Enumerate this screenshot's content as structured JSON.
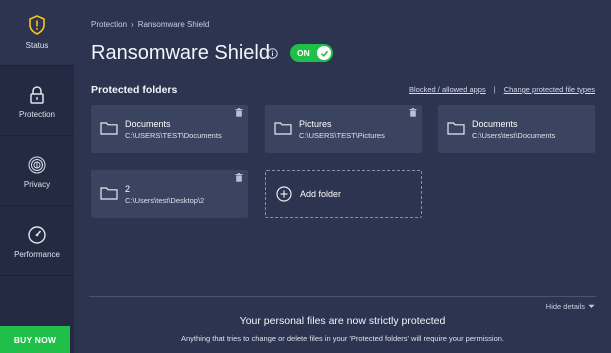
{
  "sidebar": {
    "items": [
      {
        "label": "Status",
        "icon": "shield-warning-icon"
      },
      {
        "label": "Protection",
        "icon": "lock-icon"
      },
      {
        "label": "Privacy",
        "icon": "fingerprint-icon"
      },
      {
        "label": "Performance",
        "icon": "speedometer-icon"
      }
    ],
    "buy_now": "BUY NOW"
  },
  "breadcrumb": {
    "parent": "Protection",
    "separator": "›",
    "current": "Ransomware Shield"
  },
  "header": {
    "title": "Ransomware Shield",
    "toggle_label": "ON"
  },
  "section": {
    "title": "Protected folders",
    "links": {
      "blocked": "Blocked / allowed apps",
      "separator": "|",
      "change": "Change protected file types"
    }
  },
  "folders": [
    {
      "name": "Documents",
      "path": "C:\\USERS\\TEST\\Documents"
    },
    {
      "name": "Pictures",
      "path": "C:\\USERS\\TEST\\Pictures"
    },
    {
      "name": "Documents",
      "path": "C:\\Users\\test\\Documents"
    },
    {
      "name": "2",
      "path": "C:\\Users\\test\\Desktop\\2"
    }
  ],
  "add_folder": "Add folder",
  "details": {
    "hide": "Hide details",
    "title": "Your personal files are now strictly protected",
    "text": "Anything that tries to change or delete files in your 'Protected folders' will require your permission."
  },
  "colors": {
    "accent_green": "#1fbf4a",
    "sidebar_bg": "#232a42",
    "main_bg": "#2c3450",
    "card_bg": "#3a4360",
    "status_yellow": "#f5c518"
  }
}
